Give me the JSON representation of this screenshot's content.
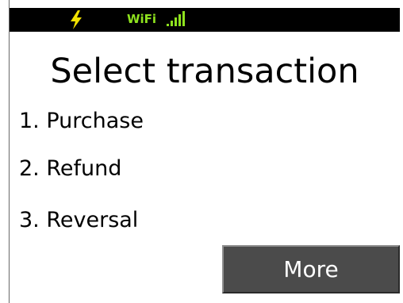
{
  "status_bar": {
    "charging_icon": "lightning-bolt-icon",
    "wifi_label": "WiFi",
    "signal_icon": "signal-strength-icon",
    "colors": {
      "background": "#000000",
      "bolt": "#f2e200",
      "wifi": "#8ee21e"
    }
  },
  "screen": {
    "title": "Select transaction"
  },
  "menu": {
    "items": [
      {
        "label": "1. Purchase"
      },
      {
        "label": "2. Refund"
      },
      {
        "label": "3. Reversal"
      }
    ]
  },
  "buttons": {
    "more_label": "More",
    "more_color": "#4b4b4b"
  }
}
